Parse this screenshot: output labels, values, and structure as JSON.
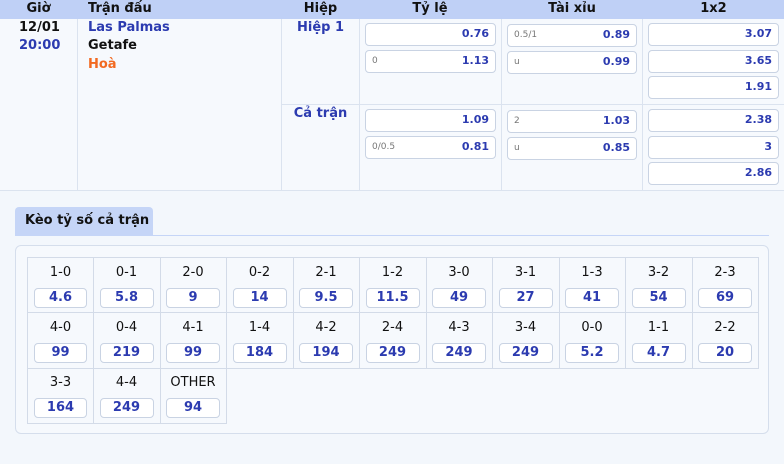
{
  "headers": {
    "time": "Giờ",
    "match": "Trận đấu",
    "half": "Hiệp",
    "handicap": "Tỷ lệ",
    "overunder": "Tài xỉu",
    "x12": "1x2"
  },
  "match": {
    "date": "12/01",
    "time": "20:00",
    "home": "Las Palmas",
    "away": "Getafe",
    "draw": "Hoà"
  },
  "periods": [
    {
      "label": "Hiệp 1",
      "handicap": [
        {
          "line": "",
          "odds": "0.76"
        },
        {
          "line": "0",
          "odds": "1.13"
        }
      ],
      "overunder": [
        {
          "line": "0.5/1",
          "odds": "0.89"
        },
        {
          "line": "u",
          "odds": "0.99"
        }
      ],
      "x12": [
        "3.07",
        "3.65",
        "1.91"
      ]
    },
    {
      "label": "Cả trận",
      "handicap": [
        {
          "line": "",
          "odds": "1.09"
        },
        {
          "line": "0/0.5",
          "odds": "0.81"
        }
      ],
      "overunder": [
        {
          "line": "2",
          "odds": "1.03"
        },
        {
          "line": "u",
          "odds": "0.85"
        }
      ],
      "x12": [
        "2.38",
        "3",
        "2.86"
      ]
    }
  ],
  "score_tab": {
    "label": "Kèo tỷ số cả trận"
  },
  "scores": [
    {
      "score": "1-0",
      "odds": "4.6"
    },
    {
      "score": "0-1",
      "odds": "5.8"
    },
    {
      "score": "2-0",
      "odds": "9"
    },
    {
      "score": "0-2",
      "odds": "14"
    },
    {
      "score": "2-1",
      "odds": "9.5"
    },
    {
      "score": "1-2",
      "odds": "11.5"
    },
    {
      "score": "3-0",
      "odds": "49"
    },
    {
      "score": "3-1",
      "odds": "27"
    },
    {
      "score": "1-3",
      "odds": "41"
    },
    {
      "score": "3-2",
      "odds": "54"
    },
    {
      "score": "2-3",
      "odds": "69"
    },
    {
      "score": "4-0",
      "odds": "99"
    },
    {
      "score": "0-4",
      "odds": "219"
    },
    {
      "score": "4-1",
      "odds": "99"
    },
    {
      "score": "1-4",
      "odds": "184"
    },
    {
      "score": "4-2",
      "odds": "194"
    },
    {
      "score": "2-4",
      "odds": "249"
    },
    {
      "score": "4-3",
      "odds": "249"
    },
    {
      "score": "3-4",
      "odds": "249"
    },
    {
      "score": "0-0",
      "odds": "5.2"
    },
    {
      "score": "1-1",
      "odds": "4.7"
    },
    {
      "score": "2-2",
      "odds": "20"
    },
    {
      "score": "3-3",
      "odds": "164"
    },
    {
      "score": "4-4",
      "odds": "249"
    },
    {
      "score": "OTHER",
      "odds": "94"
    }
  ]
}
